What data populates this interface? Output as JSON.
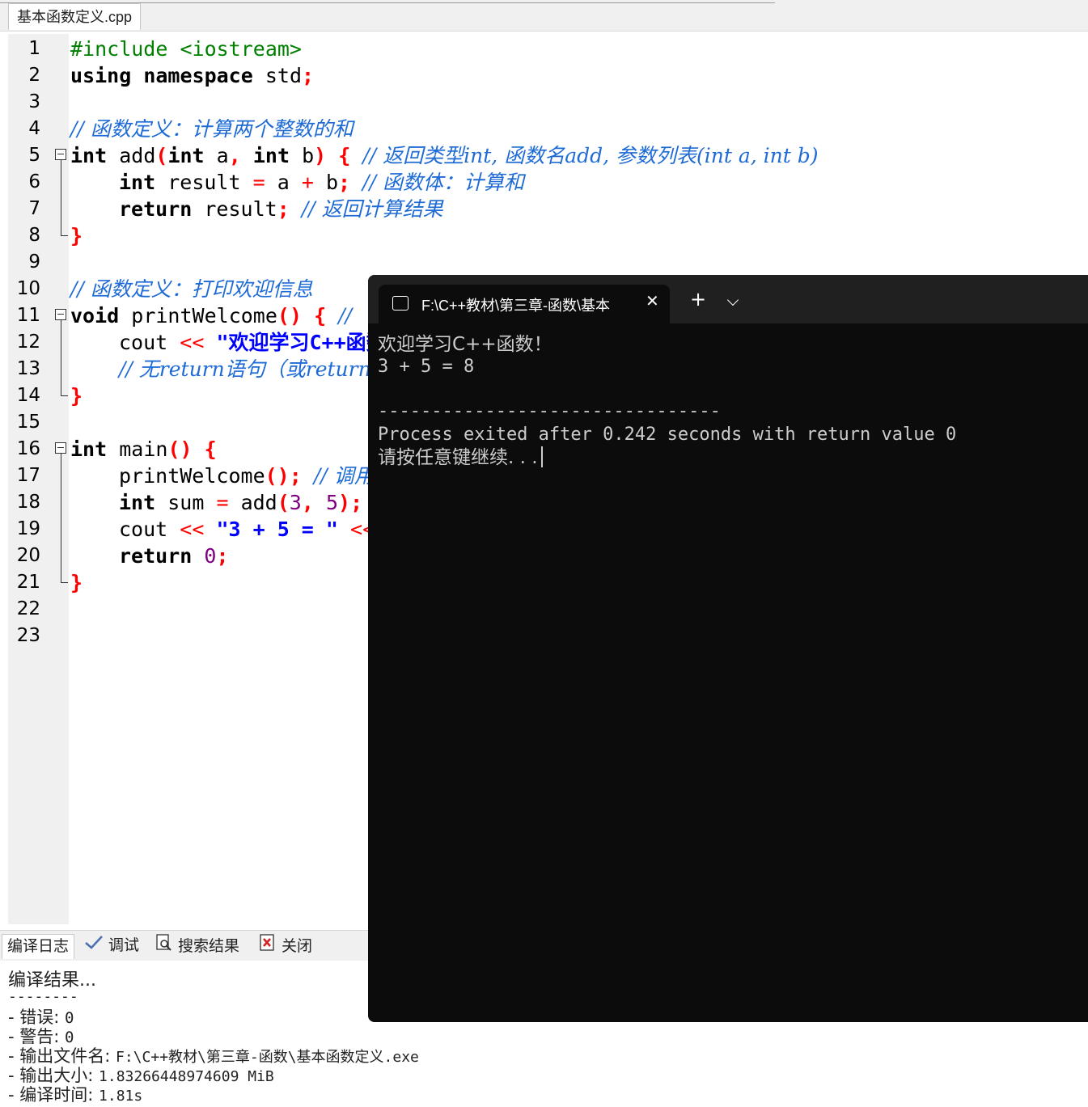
{
  "editor": {
    "file_tab": "基本函数定义.cpp",
    "line_numbers": [
      "1",
      "2",
      "3",
      "4",
      "5",
      "6",
      "7",
      "8",
      "9",
      "10",
      "11",
      "12",
      "13",
      "14",
      "15",
      "16",
      "17",
      "18",
      "19",
      "20",
      "21",
      "22",
      "23"
    ],
    "code": {
      "l1_include": "#include <iostream>",
      "l2_using": "using",
      "l2_namespace": "namespace",
      "l2_std": "std",
      "l2_semi": ";",
      "l4_comment": "// 函数定义：计算两个整数的和",
      "l5_int": "int",
      "l5_name": "add",
      "l5_lp": "(",
      "l5_int2": "int",
      "l5_a": "a",
      "l5_comma": ",",
      "l5_int3": "int",
      "l5_b": "b",
      "l5_rp": ")",
      "l5_brace": "{",
      "l5_comment": "// 返回类型int, 函数名add, 参数列表(int a, int b)",
      "l6_int": "int",
      "l6_result": "result",
      "l6_eq": "=",
      "l6_a": "a",
      "l6_plus": "+",
      "l6_b": "b",
      "l6_semi": ";",
      "l6_comment": "// 函数体：计算和",
      "l7_return": "return",
      "l7_result": "result",
      "l7_semi": ";",
      "l7_comment": "// 返回计算结果",
      "l8_brace": "}",
      "l10_comment": "// 函数定义：打印欢迎信息",
      "l11_void": "void",
      "l11_name": "printWelcome",
      "l11_parens": "()",
      "l11_brace": "{",
      "l11_comment": "//",
      "l12_cout": "cout",
      "l12_op": "<<",
      "l12_str": "\"欢迎学习C++函数！\"",
      "l13_comment": "// 无return语句（或return;）",
      "l14_brace": "}",
      "l16_int": "int",
      "l16_main": "main",
      "l16_parens": "()",
      "l16_brace": "{",
      "l17_call": "printWelcome",
      "l17_paren": "();",
      "l17_comment": "// 调用函数",
      "l18_int": "int",
      "l18_sum": "sum",
      "l18_eq": "=",
      "l18_add": "add",
      "l18_lp": "(",
      "l18_n3": "3",
      "l18_comma": ",",
      "l18_n5": "5",
      "l18_rp": ");",
      "l19_cout": "cout",
      "l19_op": "<<",
      "l19_str": "\"3 + 5 = \"",
      "l19_op2": "<<",
      "l20_return": "return",
      "l20_zero": "0",
      "l20_semi": ";",
      "l21_brace": "}"
    }
  },
  "bottom_tabs": {
    "compile_log": "编译日志",
    "debug": "调试",
    "search_results": "搜索结果",
    "close": "关闭"
  },
  "compile_log": {
    "header": "编译结果...",
    "separator": "--------",
    "errors_label": "- 错误: ",
    "errors_value": "0",
    "warnings_label": "- 警告: ",
    "warnings_value": "0",
    "output_file_label": "- 输出文件名: ",
    "output_file_value": "F:\\C++教材\\第三章-函数\\基本函数定义.exe",
    "output_size_label": "- 输出大小: ",
    "output_size_value": "1.83266448974609 MiB",
    "compile_time_label": "- 编译时间: ",
    "compile_time_value": "1.81s"
  },
  "terminal": {
    "tab_title": "F:\\C++教材\\第三章-函数\\基本",
    "close_glyph": "✕",
    "new_tab_glyph": "+",
    "output_line1": "欢迎学习C++函数！",
    "output_line2": "3 + 5 = 8",
    "separator": "--------------------------------",
    "process_line": "Process exited after 0.242 seconds with return value 0",
    "press_key": "请按任意键继续. . ."
  },
  "colors": {
    "keyword": "#000000",
    "preprocessor": "#008000",
    "operator": "#ff0000",
    "comment": "#1e6bd6",
    "string": "#0000ff",
    "number": "#800080",
    "current_line": "#ccf3fb",
    "terminal_bg": "#0c0c0c",
    "terminal_text": "#cccccc"
  }
}
